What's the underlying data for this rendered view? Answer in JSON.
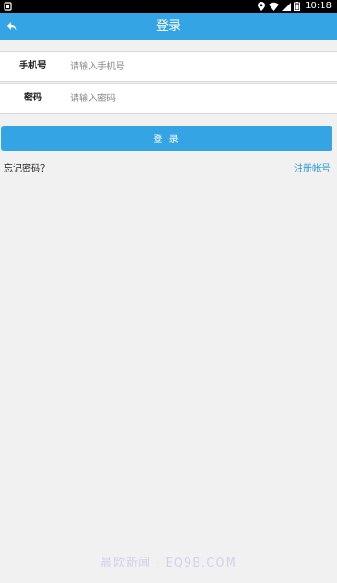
{
  "status_bar": {
    "time": "10:18",
    "icons": [
      "notification-icon",
      "location-icon",
      "wifi-icon",
      "signal-icon",
      "battery-icon"
    ]
  },
  "header": {
    "title": "登录",
    "back_icon": "back-arrow-icon",
    "background_color": "#35a4e4"
  },
  "form": {
    "phone": {
      "label": "手机号",
      "placeholder": "请输入手机号",
      "value": ""
    },
    "password": {
      "label": "密码",
      "placeholder": "请输入密码",
      "value": ""
    }
  },
  "login_button": {
    "label": "登 录",
    "color": "#35a4e4"
  },
  "links": {
    "forgot_password": "忘记密码？",
    "register": "注册帐号"
  },
  "watermark": "晨欧新闻 · EQ9B.COM"
}
